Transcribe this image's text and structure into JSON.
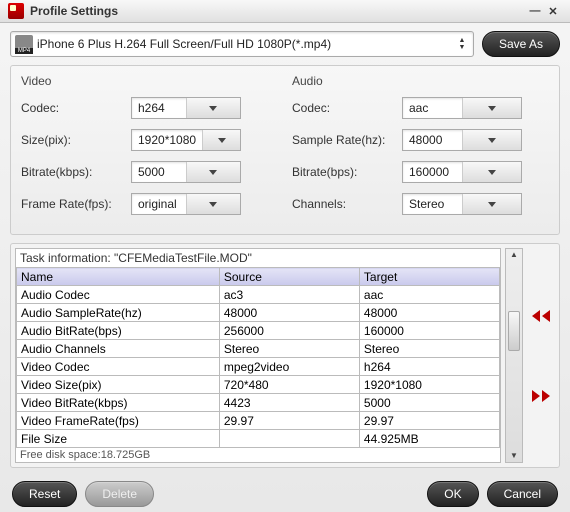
{
  "title": "Profile Settings",
  "profile": {
    "text": "iPhone 6 Plus H.264 Full Screen/Full HD 1080P(*.mp4)"
  },
  "buttons": {
    "saveas": "Save As",
    "reset": "Reset",
    "delete": "Delete",
    "ok": "OK",
    "cancel": "Cancel"
  },
  "video": {
    "header": "Video",
    "codec_label": "Codec:",
    "codec": "h264",
    "size_label": "Size(pix):",
    "size": "1920*1080",
    "bitrate_label": "Bitrate(kbps):",
    "bitrate": "5000",
    "fps_label": "Frame Rate(fps):",
    "fps": "original"
  },
  "audio": {
    "header": "Audio",
    "codec_label": "Codec:",
    "codec": "aac",
    "sr_label": "Sample Rate(hz):",
    "sr": "48000",
    "bitrate_label": "Bitrate(bps):",
    "bitrate": "160000",
    "ch_label": "Channels:",
    "ch": "Stereo"
  },
  "task": {
    "info": "Task information: \"CFEMediaTestFile.MOD\"",
    "headers": {
      "name": "Name",
      "source": "Source",
      "target": "Target"
    },
    "rows": [
      {
        "name": "Audio Codec",
        "source": "ac3",
        "target": "aac"
      },
      {
        "name": "Audio SampleRate(hz)",
        "source": "48000",
        "target": "48000"
      },
      {
        "name": "Audio BitRate(bps)",
        "source": "256000",
        "target": "160000"
      },
      {
        "name": "Audio Channels",
        "source": "Stereo",
        "target": "Stereo"
      },
      {
        "name": "Video Codec",
        "source": "mpeg2video",
        "target": "h264"
      },
      {
        "name": "Video Size(pix)",
        "source": "720*480",
        "target": "1920*1080"
      },
      {
        "name": "Video BitRate(kbps)",
        "source": "4423",
        "target": "5000"
      },
      {
        "name": "Video FrameRate(fps)",
        "source": "29.97",
        "target": "29.97"
      },
      {
        "name": "File Size",
        "source": "",
        "target": "44.925MB"
      }
    ],
    "freedisk": "Free disk space:18.725GB"
  }
}
